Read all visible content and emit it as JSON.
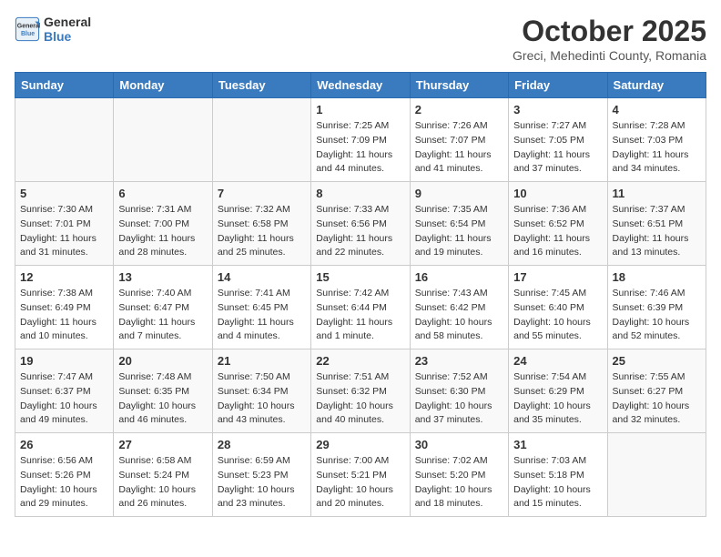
{
  "logo": {
    "line1": "General",
    "line2": "Blue"
  },
  "title": "October 2025",
  "subtitle": "Greci, Mehedinti County, Romania",
  "weekdays": [
    "Sunday",
    "Monday",
    "Tuesday",
    "Wednesday",
    "Thursday",
    "Friday",
    "Saturday"
  ],
  "weeks": [
    [
      {
        "day": "",
        "empty": true
      },
      {
        "day": "",
        "empty": true
      },
      {
        "day": "",
        "empty": true
      },
      {
        "day": "1",
        "sunrise": "7:25 AM",
        "sunset": "7:09 PM",
        "daylight": "11 hours and 44 minutes."
      },
      {
        "day": "2",
        "sunrise": "7:26 AM",
        "sunset": "7:07 PM",
        "daylight": "11 hours and 41 minutes."
      },
      {
        "day": "3",
        "sunrise": "7:27 AM",
        "sunset": "7:05 PM",
        "daylight": "11 hours and 37 minutes."
      },
      {
        "day": "4",
        "sunrise": "7:28 AM",
        "sunset": "7:03 PM",
        "daylight": "11 hours and 34 minutes."
      }
    ],
    [
      {
        "day": "5",
        "sunrise": "7:30 AM",
        "sunset": "7:01 PM",
        "daylight": "11 hours and 31 minutes."
      },
      {
        "day": "6",
        "sunrise": "7:31 AM",
        "sunset": "7:00 PM",
        "daylight": "11 hours and 28 minutes."
      },
      {
        "day": "7",
        "sunrise": "7:32 AM",
        "sunset": "6:58 PM",
        "daylight": "11 hours and 25 minutes."
      },
      {
        "day": "8",
        "sunrise": "7:33 AM",
        "sunset": "6:56 PM",
        "daylight": "11 hours and 22 minutes."
      },
      {
        "day": "9",
        "sunrise": "7:35 AM",
        "sunset": "6:54 PM",
        "daylight": "11 hours and 19 minutes."
      },
      {
        "day": "10",
        "sunrise": "7:36 AM",
        "sunset": "6:52 PM",
        "daylight": "11 hours and 16 minutes."
      },
      {
        "day": "11",
        "sunrise": "7:37 AM",
        "sunset": "6:51 PM",
        "daylight": "11 hours and 13 minutes."
      }
    ],
    [
      {
        "day": "12",
        "sunrise": "7:38 AM",
        "sunset": "6:49 PM",
        "daylight": "11 hours and 10 minutes."
      },
      {
        "day": "13",
        "sunrise": "7:40 AM",
        "sunset": "6:47 PM",
        "daylight": "11 hours and 7 minutes."
      },
      {
        "day": "14",
        "sunrise": "7:41 AM",
        "sunset": "6:45 PM",
        "daylight": "11 hours and 4 minutes."
      },
      {
        "day": "15",
        "sunrise": "7:42 AM",
        "sunset": "6:44 PM",
        "daylight": "11 hours and 1 minute."
      },
      {
        "day": "16",
        "sunrise": "7:43 AM",
        "sunset": "6:42 PM",
        "daylight": "10 hours and 58 minutes."
      },
      {
        "day": "17",
        "sunrise": "7:45 AM",
        "sunset": "6:40 PM",
        "daylight": "10 hours and 55 minutes."
      },
      {
        "day": "18",
        "sunrise": "7:46 AM",
        "sunset": "6:39 PM",
        "daylight": "10 hours and 52 minutes."
      }
    ],
    [
      {
        "day": "19",
        "sunrise": "7:47 AM",
        "sunset": "6:37 PM",
        "daylight": "10 hours and 49 minutes."
      },
      {
        "day": "20",
        "sunrise": "7:48 AM",
        "sunset": "6:35 PM",
        "daylight": "10 hours and 46 minutes."
      },
      {
        "day": "21",
        "sunrise": "7:50 AM",
        "sunset": "6:34 PM",
        "daylight": "10 hours and 43 minutes."
      },
      {
        "day": "22",
        "sunrise": "7:51 AM",
        "sunset": "6:32 PM",
        "daylight": "10 hours and 40 minutes."
      },
      {
        "day": "23",
        "sunrise": "7:52 AM",
        "sunset": "6:30 PM",
        "daylight": "10 hours and 37 minutes."
      },
      {
        "day": "24",
        "sunrise": "7:54 AM",
        "sunset": "6:29 PM",
        "daylight": "10 hours and 35 minutes."
      },
      {
        "day": "25",
        "sunrise": "7:55 AM",
        "sunset": "6:27 PM",
        "daylight": "10 hours and 32 minutes."
      }
    ],
    [
      {
        "day": "26",
        "sunrise": "6:56 AM",
        "sunset": "5:26 PM",
        "daylight": "10 hours and 29 minutes."
      },
      {
        "day": "27",
        "sunrise": "6:58 AM",
        "sunset": "5:24 PM",
        "daylight": "10 hours and 26 minutes."
      },
      {
        "day": "28",
        "sunrise": "6:59 AM",
        "sunset": "5:23 PM",
        "daylight": "10 hours and 23 minutes."
      },
      {
        "day": "29",
        "sunrise": "7:00 AM",
        "sunset": "5:21 PM",
        "daylight": "10 hours and 20 minutes."
      },
      {
        "day": "30",
        "sunrise": "7:02 AM",
        "sunset": "5:20 PM",
        "daylight": "10 hours and 18 minutes."
      },
      {
        "day": "31",
        "sunrise": "7:03 AM",
        "sunset": "5:18 PM",
        "daylight": "10 hours and 15 minutes."
      },
      {
        "day": "",
        "empty": true
      }
    ]
  ]
}
